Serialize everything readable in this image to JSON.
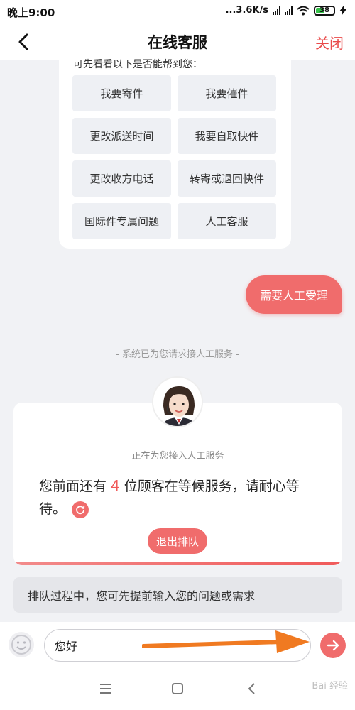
{
  "status_bar": {
    "time": "晚上9:00",
    "speed": "...3.6K/s",
    "battery": "38"
  },
  "header": {
    "title": "在线客服",
    "close": "关闭"
  },
  "menu": {
    "cut_text": "可先看看以下是否能帮到您：",
    "options": [
      "我要寄件",
      "我要催件",
      "更改派送时间",
      "我要自取快件",
      "更改收方电话",
      "转寄或退回快件",
      "国际件专属问题",
      "人工客服"
    ]
  },
  "user_bubble": "需要人工受理",
  "system_message": "- 系统已为您请求接人工服务 -",
  "queue": {
    "status": "正在为您接入人工服务",
    "text_before": "您前面还有",
    "count": "4",
    "text_after": "位顾客在等候服务，请耐心等待。",
    "exit_button": "退出排队"
  },
  "notice": "排队过程中，您可先提前输入您的问题或需求",
  "input": {
    "value": "您好"
  },
  "watermark": "Bai 经验",
  "colors": {
    "accent": "#f06c6c",
    "close": "#e94a4a",
    "background": "#f1f2f5"
  },
  "icons": {
    "back": "chevron-left-icon",
    "send": "arrow-right-icon",
    "emoji": "smiley-icon",
    "refresh": "refresh-icon"
  }
}
